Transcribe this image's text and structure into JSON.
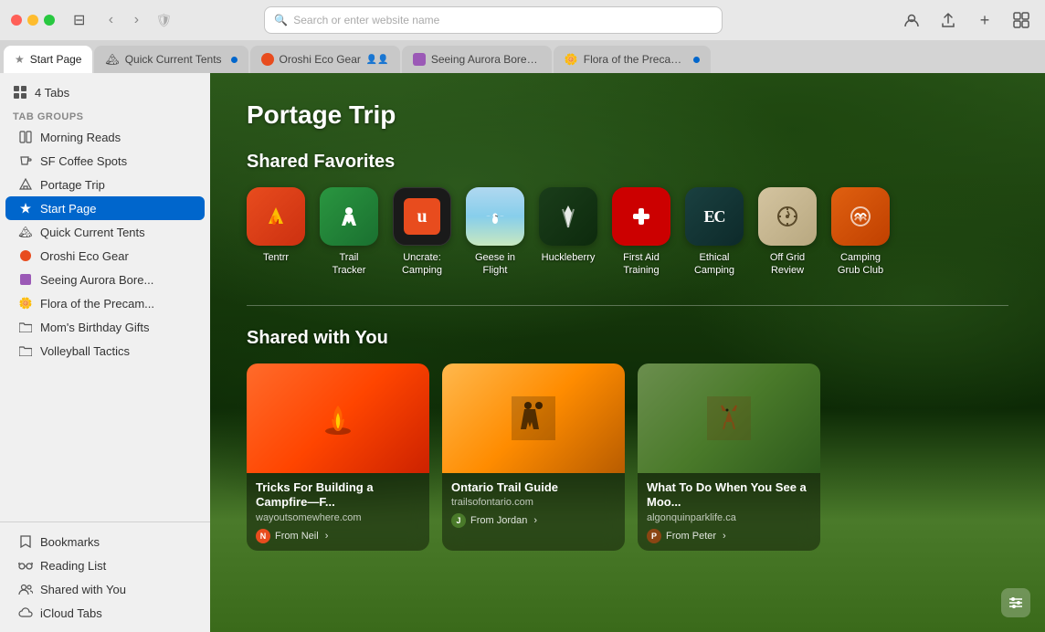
{
  "titlebar": {
    "back_label": "‹",
    "forward_label": "›",
    "search_placeholder": "Search or enter website name"
  },
  "tabs": [
    {
      "id": "start",
      "label": "Start Page",
      "type": "star",
      "active": true,
      "dot": false,
      "dot_color": ""
    },
    {
      "id": "quick-current-tents",
      "label": "Quick Current Tents",
      "type": "mountain",
      "active": false,
      "dot": true,
      "dot_color": "#0066cc"
    },
    {
      "id": "oroshi",
      "label": "Oroshi Eco Gear",
      "type": "circle-red",
      "active": false,
      "dot": false,
      "dot_color": ""
    },
    {
      "id": "aurora",
      "label": "Seeing Aurora Boreali...",
      "type": "purple",
      "active": false,
      "dot": false,
      "dot_color": ""
    },
    {
      "id": "flora",
      "label": "Flora of the Precambi...",
      "type": "yellow-flower",
      "active": false,
      "dot": true,
      "dot_color": "#0066cc"
    }
  ],
  "sidebar": {
    "tabs_count": "4 Tabs",
    "section_label": "Tab Groups",
    "groups": [
      {
        "id": "morning-reads",
        "label": "Morning Reads",
        "icon": "book"
      },
      {
        "id": "sf-coffee",
        "label": "SF Coffee Spots",
        "icon": "coffee"
      },
      {
        "id": "portage-trip",
        "label": "Portage Trip",
        "icon": "tent"
      },
      {
        "id": "start-page",
        "label": "Start Page",
        "icon": "star",
        "active": true
      },
      {
        "id": "quick-current-tents",
        "label": "Quick Current Tents",
        "icon": "mountain"
      },
      {
        "id": "oroshi-eco",
        "label": "Oroshi Eco Gear",
        "icon": "circle-red"
      },
      {
        "id": "seeing-aurora",
        "label": "Seeing Aurora Bore...",
        "icon": "purple-dot"
      },
      {
        "id": "flora",
        "label": "Flora of the Precam...",
        "icon": "flower"
      },
      {
        "id": "moms-birthday",
        "label": "Mom's Birthday Gifts",
        "icon": "folder"
      },
      {
        "id": "volleyball",
        "label": "Volleyball Tactics",
        "icon": "folder"
      }
    ],
    "bottom_items": [
      {
        "id": "bookmarks",
        "label": "Bookmarks",
        "icon": "bookmark"
      },
      {
        "id": "reading-list",
        "label": "Reading List",
        "icon": "glasses"
      },
      {
        "id": "shared-with-you",
        "label": "Shared with You",
        "icon": "people"
      },
      {
        "id": "icloud-tabs",
        "label": "iCloud Tabs",
        "icon": "cloud"
      }
    ]
  },
  "content": {
    "page_title": "Portage Trip",
    "favorites_title": "Shared Favorites",
    "favorites": [
      {
        "id": "tentrr",
        "label": "Tentrr",
        "bg": "#e84c1e",
        "emoji": "🔥"
      },
      {
        "id": "trail-tracker",
        "label": "Trail\nTracker",
        "bg": "#2a9640",
        "emoji": "🥾"
      },
      {
        "id": "uncrate",
        "label": "Uncrate:\nCamping",
        "bg": "#1a1a1a",
        "emoji": "⬛"
      },
      {
        "id": "geese-in-flight",
        "label": "Geese in\nFlight",
        "bg": "#87ceeb",
        "emoji": "🦢"
      },
      {
        "id": "huckleberry",
        "label": "Huckleberry",
        "bg": "#1a3d1a",
        "emoji": "🌲"
      },
      {
        "id": "first-aid",
        "label": "First Aid\nTraining",
        "bg": "#cc0000",
        "emoji": "➕"
      },
      {
        "id": "ethical-camping",
        "label": "Ethical\nCamping",
        "bg": "#1a4040",
        "emoji": "EC"
      },
      {
        "id": "off-grid",
        "label": "Off Grid\nReview",
        "bg": "#d4c4a0",
        "emoji": "🧭"
      },
      {
        "id": "camping-grub",
        "label": "Camping\nGrub Club",
        "bg": "#e06010",
        "emoji": "🌀"
      }
    ],
    "shared_with_you_title": "Shared with You",
    "shared_cards": [
      {
        "id": "campfire",
        "title": "Tricks For Building a Campfire—F...",
        "domain": "wayoutsomewhere.com",
        "from": "Neil",
        "from_color": "#e84c1e",
        "emoji": "🔥"
      },
      {
        "id": "trail",
        "title": "Ontario Trail Guide",
        "domain": "trailsofontario.com",
        "from": "Jordan",
        "from_color": "#4a7a2a",
        "emoji": "🚶"
      },
      {
        "id": "moose",
        "title": "What To Do When You See a Moo...",
        "domain": "algonquinparklife.ca",
        "from": "Peter",
        "from_color": "#8B4513",
        "emoji": "🦌"
      }
    ]
  }
}
